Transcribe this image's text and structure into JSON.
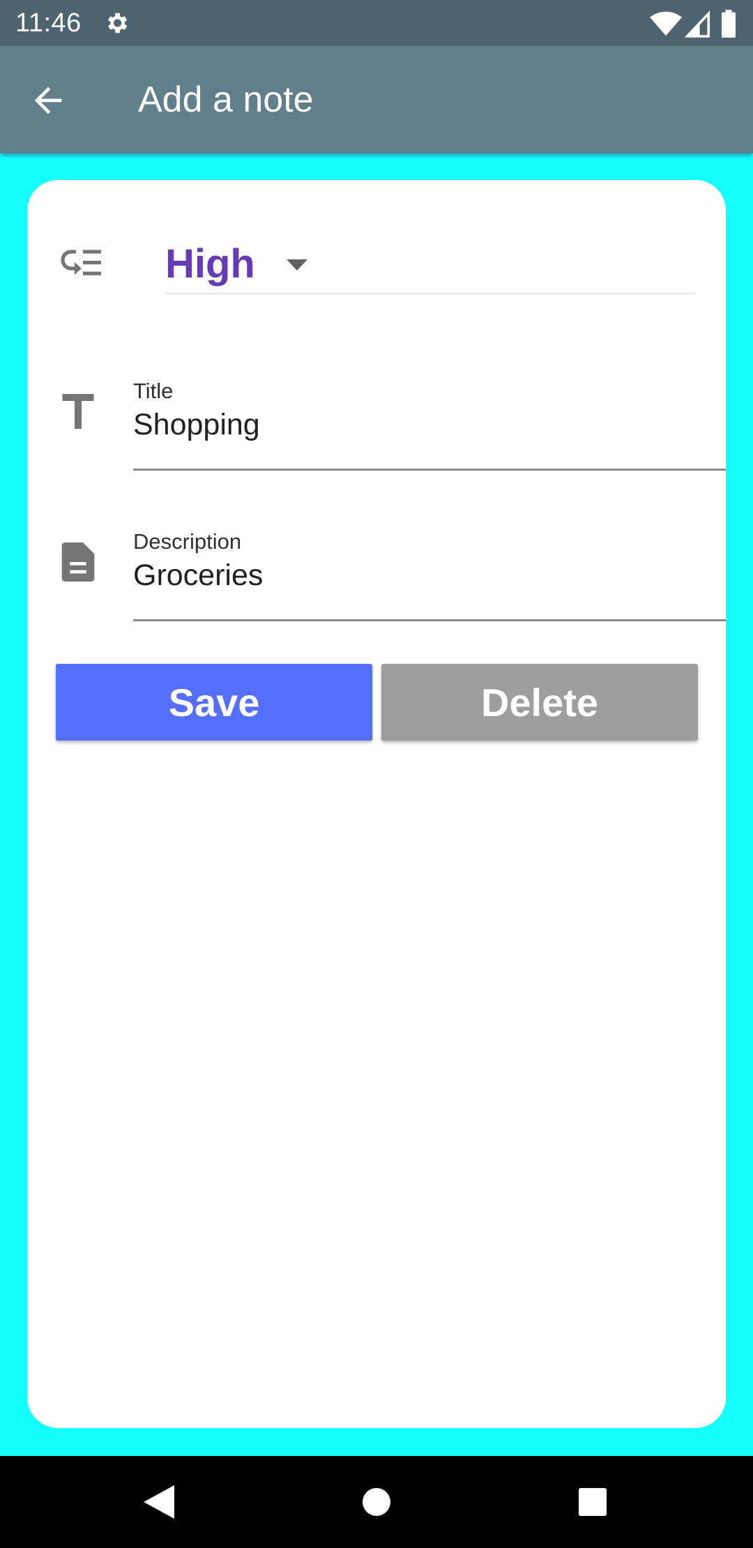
{
  "status_bar": {
    "time": "11:46",
    "icons": [
      "settings-icon",
      "wifi-icon",
      "signal-icon",
      "battery-icon"
    ]
  },
  "app_bar": {
    "title": "Add a note",
    "back_icon": "arrow-back-icon"
  },
  "form": {
    "priority": {
      "icon": "priority-icon",
      "selected": "High"
    },
    "title_field": {
      "icon": "title-icon",
      "label": "Title",
      "value": "Shopping"
    },
    "description_field": {
      "icon": "description-icon",
      "label": "Description",
      "value": "Groceries"
    },
    "save_label": "Save",
    "delete_label": "Delete"
  },
  "nav_bar": {
    "icons": [
      "back-triangle-icon",
      "home-circle-icon",
      "recents-square-icon"
    ]
  },
  "colors": {
    "background": "#16ffff",
    "status_bar": "#4e6470",
    "app_bar": "#627f8c",
    "priority_text": "#673ab7",
    "save_button": "#546ffe",
    "delete_button": "#9e9e9e"
  }
}
